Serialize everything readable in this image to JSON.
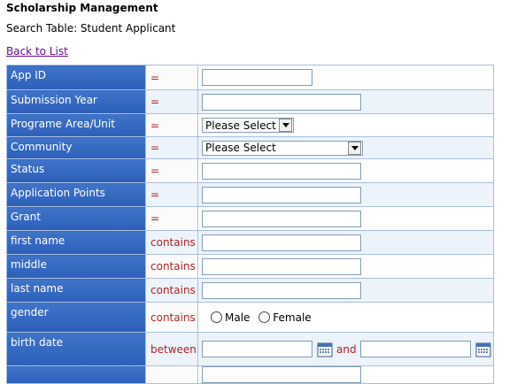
{
  "header": {
    "app_title": "Scholarship Management",
    "caption": "Search Table: Student Applicant",
    "back_link": "Back to List"
  },
  "rows": [
    {
      "field": "App ID",
      "op": "="
    },
    {
      "field": "Submission Year",
      "op": "="
    },
    {
      "field": "Programe Area/Unit",
      "op": "=",
      "select": "Please Select"
    },
    {
      "field": "Community",
      "op": "=",
      "select": "Please Select"
    },
    {
      "field": "Status",
      "op": "="
    },
    {
      "field": "Application Points",
      "op": "="
    },
    {
      "field": "Grant",
      "op": "="
    },
    {
      "field": "first name",
      "op": "contains"
    },
    {
      "field": "middle",
      "op": "contains"
    },
    {
      "field": "last name",
      "op": "contains"
    },
    {
      "field": "gender",
      "op": "contains",
      "options": [
        "Male",
        "Female"
      ]
    },
    {
      "field": "birth date",
      "op": "between",
      "and_label": "and"
    }
  ],
  "colors": {
    "header_blue": "#3f74c9",
    "operator_red": "#b32222",
    "link_purple": "#6a0a8a"
  }
}
